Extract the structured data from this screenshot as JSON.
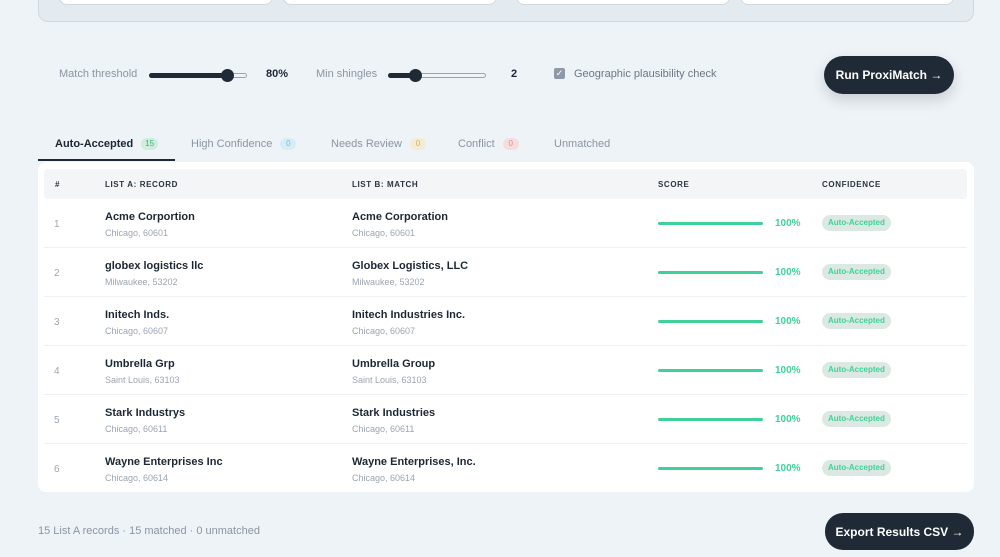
{
  "controls": {
    "match_threshold_label": "Match threshold",
    "match_threshold_value": "80%",
    "match_threshold_fraction": 0.8,
    "min_shingles_label": "Min shingles",
    "min_shingles_value": "2",
    "min_shingles_fraction": 0.28,
    "geo_check_label": "Geographic plausibility check",
    "geo_check_checked": true,
    "run_button": "Run ProxiMatch →"
  },
  "tabs": [
    {
      "label": "Auto-Accepted",
      "count": "15",
      "badge_bg": "#cdeedd",
      "badge_color": "#3ab37f"
    },
    {
      "label": "High Confidence",
      "count": "0",
      "badge_bg": "#d8ecf7",
      "badge_color": "#7fb7d4"
    },
    {
      "label": "Needs Review",
      "count": "0",
      "badge_bg": "#f3ebd2",
      "badge_color": "#c9b26e"
    },
    {
      "label": "Conflict",
      "count": "0",
      "badge_bg": "#f6dcdc",
      "badge_color": "#d99191"
    },
    {
      "label": "Unmatched",
      "count": "",
      "badge_bg": "",
      "badge_color": ""
    }
  ],
  "table": {
    "headers": {
      "num": "#",
      "list_a": "LIST A: RECORD",
      "list_b": "LIST B: MATCH",
      "score": "SCORE",
      "confidence": "CONFIDENCE"
    },
    "rows": [
      {
        "num": "1",
        "a_name": "Acme Corportion",
        "a_loc": "Chicago, 60601",
        "b_name": "Acme Corporation",
        "b_loc": "Chicago, 60601",
        "score": "100%",
        "confidence": "Auto-Accepted"
      },
      {
        "num": "2",
        "a_name": "globex logistics llc",
        "a_loc": "Milwaukee, 53202",
        "b_name": "Globex Logistics, LLC",
        "b_loc": "Milwaukee, 53202",
        "score": "100%",
        "confidence": "Auto-Accepted"
      },
      {
        "num": "3",
        "a_name": "Initech Inds.",
        "a_loc": "Chicago, 60607",
        "b_name": "Initech Industries Inc.",
        "b_loc": "Chicago, 60607",
        "score": "100%",
        "confidence": "Auto-Accepted"
      },
      {
        "num": "4",
        "a_name": "Umbrella Grp",
        "a_loc": "Saint Louis, 63103",
        "b_name": "Umbrella Group",
        "b_loc": "Saint Louis, 63103",
        "score": "100%",
        "confidence": "Auto-Accepted"
      },
      {
        "num": "5",
        "a_name": "Stark Industrys",
        "a_loc": "Chicago, 60611",
        "b_name": "Stark Industries",
        "b_loc": "Chicago, 60611",
        "score": "100%",
        "confidence": "Auto-Accepted"
      },
      {
        "num": "6",
        "a_name": "Wayne Enterprises Inc",
        "a_loc": "Chicago, 60614",
        "b_name": "Wayne Enterprises, Inc.",
        "b_loc": "Chicago, 60614",
        "score": "100%",
        "confidence": "Auto-Accepted"
      }
    ]
  },
  "footer": {
    "summary": "15 List A records · 15 matched · 0 unmatched",
    "export_button": "Export Results CSV →"
  },
  "colors": {
    "accent_dark": "#1f2a36",
    "score_green": "#3ed29a",
    "page_bg": "#eef3f7"
  }
}
